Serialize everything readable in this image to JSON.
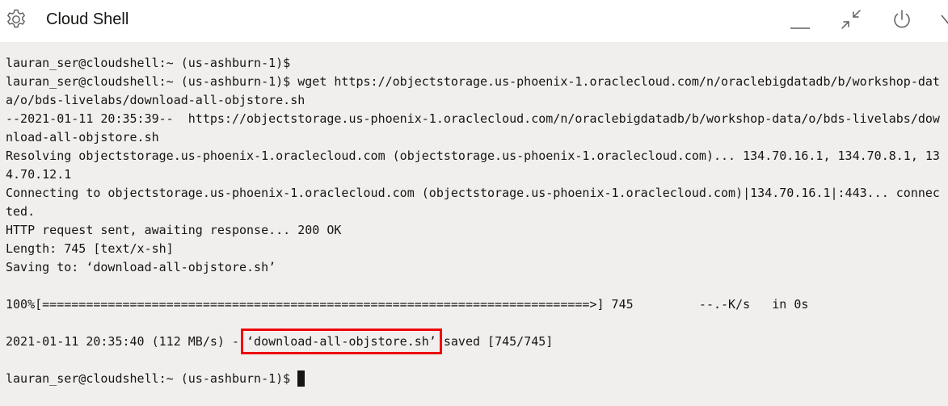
{
  "header": {
    "title": "Cloud Shell",
    "icons": {
      "settings": "gear-icon",
      "minimize": "minimize-icon",
      "restore": "restore-icon",
      "power": "power-icon"
    }
  },
  "terminal": {
    "lines": [
      "lauran_ser@cloudshell:~ (us-ashburn-1)$",
      "lauran_ser@cloudshell:~ (us-ashburn-1)$ wget https://objectstorage.us-phoenix-1.oraclecloud.com/n/oraclebigdatadb/b/workshop-dat",
      "a/o/bds-livelabs/download-all-objstore.sh",
      "--2021-01-11 20:35:39--  https://objectstorage.us-phoenix-1.oraclecloud.com/n/oraclebigdatadb/b/workshop-data/o/bds-livelabs/dow",
      "nload-all-objstore.sh",
      "Resolving objectstorage.us-phoenix-1.oraclecloud.com (objectstorage.us-phoenix-1.oraclecloud.com)... 134.70.16.1, 134.70.8.1, 13",
      "4.70.12.1",
      "Connecting to objectstorage.us-phoenix-1.oraclecloud.com (objectstorage.us-phoenix-1.oraclecloud.com)|134.70.16.1|:443... connec",
      "ted.",
      "HTTP request sent, awaiting response... 200 OK",
      "Length: 745 [text/x-sh]",
      "Saving to: ‘download-all-objstore.sh’",
      "",
      "100%[===========================================================================>] 745         --.-K/s   in 0s"
    ],
    "saved_line": {
      "prefix": "2021-01-11 20:35:40 (112 MB/s) - ",
      "filename": "‘download-all-objstore.sh’",
      "suffix": " saved [745/745]"
    },
    "prompt": "lauran_ser@cloudshell:~ (us-ashburn-1)$ "
  },
  "colors": {
    "terminal_bg": "#f1efed",
    "text": "#161513",
    "highlight_box": "#ee0000"
  }
}
